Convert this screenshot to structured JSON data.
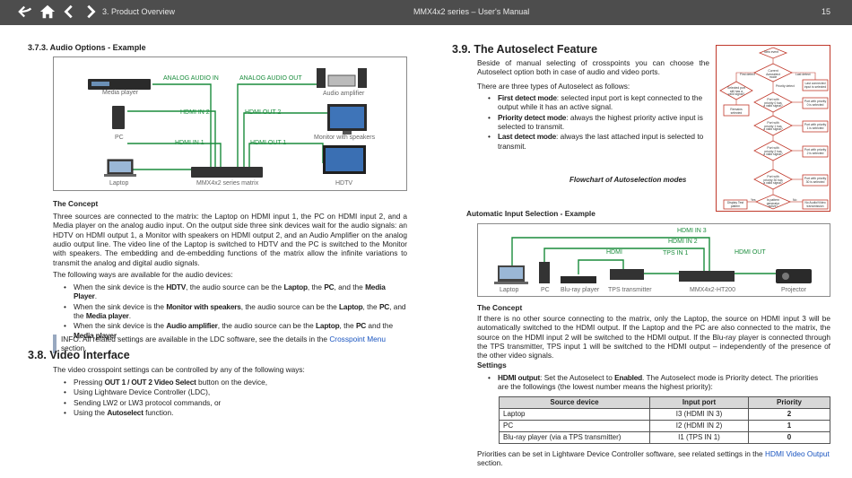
{
  "topbar": {
    "section": "3. Product Overview",
    "title": "MMX4x2 series – User's Manual",
    "page": "15"
  },
  "audio_example": {
    "heading": "3.7.3.  Audio Options - Example",
    "diagram_labels": {
      "media_player": "Media player",
      "pc": "PC",
      "laptop": "Laptop",
      "matrix": "MMX4x2 series matrix",
      "audio_amplifier": "Audio amplifier",
      "monitor": "Monitor with speakers",
      "hdtv": "HDTV",
      "analog_in": "ANALOG AUDIO IN",
      "analog_out": "ANALOG AUDIO OUT",
      "hdmi_in2": "HDMI IN 2",
      "hdmi_in1": "HDMI IN 1",
      "hdmi_out2": "HDMI OUT 2",
      "hdmi_out1": "HDMI OUT 1"
    },
    "concept_heading": "The Concept",
    "concept_text": "Three sources are connected to the matrix: the Laptop on HDMI input 1, the PC on HDMI input 2, and a Media player on the analog audio input. On the output side three sink devices wait for the audio signals: an HDTV on HDMI output 1, a Monitor with speakers on HDMI output 2, and an Audio Amplifier on the analog audio output line. The video line of the Laptop is switched to HDTV and the PC is switched to the Monitor with speakers. The embedding and de-embedding functions of the matrix allow the infinite variations to transmit the analog and digital audio signals.",
    "ways_text": "The following ways are available for the audio devices:",
    "bullets": [
      {
        "p1": "When the sink device is the ",
        "b1": "HDTV",
        "p2": ", the audio source can be the ",
        "b2": "Laptop",
        "p3": ", the ",
        "b3": "PC",
        "p4": ", and the ",
        "b4": "Media Player",
        "p5": "."
      },
      {
        "p1": "When the sink device is the ",
        "b1": "Monitor with speakers",
        "p2": ", the audio source can be the ",
        "b2": "Laptop",
        "p3": ", the ",
        "b3": "PC",
        "p4": ", and the ",
        "b4": "Media player",
        "p5": "."
      },
      {
        "p1": "When the sink device is the ",
        "b1": "Audio amplifier",
        "p2": ", the audio source can be the ",
        "b2": "Laptop",
        "p3": ", the ",
        "b3": "PC",
        "p4": " and the ",
        "b4": "Media player",
        "p5": "."
      }
    ],
    "info_prefix": "INFO: All related settings are available in the LDC software, see the details in the ",
    "info_link": "Crosspoint Menu",
    "info_suffix": " section."
  },
  "video_interface": {
    "heading": "3.8.  Video Interface",
    "intro": "The video crosspoint settings can be controlled by any of the following ways:",
    "b1_pre": "Pressing ",
    "b1_bold": "OUT 1 / OUT 2 Video Select",
    "b1_post": " button on the device,",
    "b2": "Using Lightware Device Controller (LDC),",
    "b3": "Sending LW2 or LW3 protocol commands, or",
    "b4_pre": "Using the ",
    "b4_bold": "Autoselect",
    "b4_post": " function."
  },
  "autoselect": {
    "heading": "3.9.  The Autoselect Feature",
    "intro": "Beside of manual selecting of crosspoints you can choose the Autoselect option both in case of audio and video ports.",
    "types_intro": "There are three types of Autoselect as follows:",
    "t1_bold": "First detect mode",
    "t1_text": ": selected input port is kept connected to the output while it has an active signal.",
    "t2_bold": "Priority detect mode",
    "t2_text": ": always the highest priority active input is selected to transmit.",
    "t3_bold": "Last detect mode",
    "t3_text": ": always the last attached input is selected to transmit.",
    "flowchart_caption": "Flowchart of Autoselection modes",
    "flowchart_labels": {
      "new_event": "New event",
      "first_detect": "First detect",
      "last_detect": "Last detect",
      "current_mode": "Current Autoselect mode",
      "priority_detect": "Priority detect",
      "selected_signal": "Selected port still has a valid signal?",
      "remains": "Remains selected",
      "last_connected": "Last connected input is selected",
      "p0": "Port with priority 0 has a valid signal?",
      "p0_sel": "Port with priority 0 is selected",
      "p1": "Port with priority 1 has a valid signal?",
      "p1_sel": "Port with priority 1 is selected",
      "p2": "Port with priority 2 has a valid signal?",
      "p2_sel": "Port with priority 2 is selected",
      "p30": "Port with priority 30 has a valid signal?",
      "p30_sel": "Port with priority 30 is selected",
      "pattern": "Display Test pattern",
      "noaudio": "No Audio/Video transmission",
      "test_pattern_q": "Is pattern generator active?",
      "yes": "Yes",
      "no": "No"
    },
    "auto_input_heading": "Automatic Input Selection - Example",
    "diagram_labels": {
      "laptop": "Laptop",
      "pc": "PC",
      "bluray": "Blu-ray player",
      "tps_tx": "TPS transmitter",
      "matrix": "MMX4x2-HT200",
      "projector": "Projector",
      "hdmi_in3": "HDMI IN 3",
      "hdmi_in2": "HDMI IN 2",
      "hdmi": "HDMI",
      "tps_in1": "TPS IN 1",
      "hdmi_out": "HDMI OUT"
    },
    "concept_heading": "The Concept",
    "concept_text": "If there is no other source connecting to the matrix, only the Laptop, the source on HDMI input 3 will be automatically switched to the HDMI output. If the Laptop and the PC are also connected to the matrix, the source on the HDMI input 2 will be switched to the HDMI output. If the Blu-ray player is connected through the TPS transmitter, TPS input 1 will be switched to the HDMI output – independently of the presence of the other video signals.",
    "settings_heading": "Settings",
    "setting_bold": "HDMI output",
    "setting_text1": ": Set the Autoselect to ",
    "setting_bold2": "Enabled",
    "setting_text2": ". The Autoselect mode is Priority detect. The priorities are the followings (the lowest number means the highest priority):",
    "table": {
      "headers": [
        "Source device",
        "Input port",
        "Priority"
      ],
      "rows": [
        [
          "Laptop",
          "I3 (HDMI IN 3)",
          "2"
        ],
        [
          "PC",
          "I2 (HDMI IN 2)",
          "1"
        ],
        [
          "Blu-ray player (via a TPS transmitter)",
          "I1 (TPS IN 1)",
          "0"
        ]
      ]
    },
    "footer_pre": "Priorities can be set in Lightware Device Controller software, see related settings in the ",
    "footer_link": "HDMI Video Output",
    "footer_post": " section."
  },
  "colors": {
    "topbar": "#4d4d4d",
    "cable_green": "#1a8c3c",
    "link": "#1a55c0",
    "flow_red": "#c0392b"
  },
  "icons": [
    "back-icon",
    "home-icon",
    "prev-page-icon",
    "next-page-icon"
  ]
}
